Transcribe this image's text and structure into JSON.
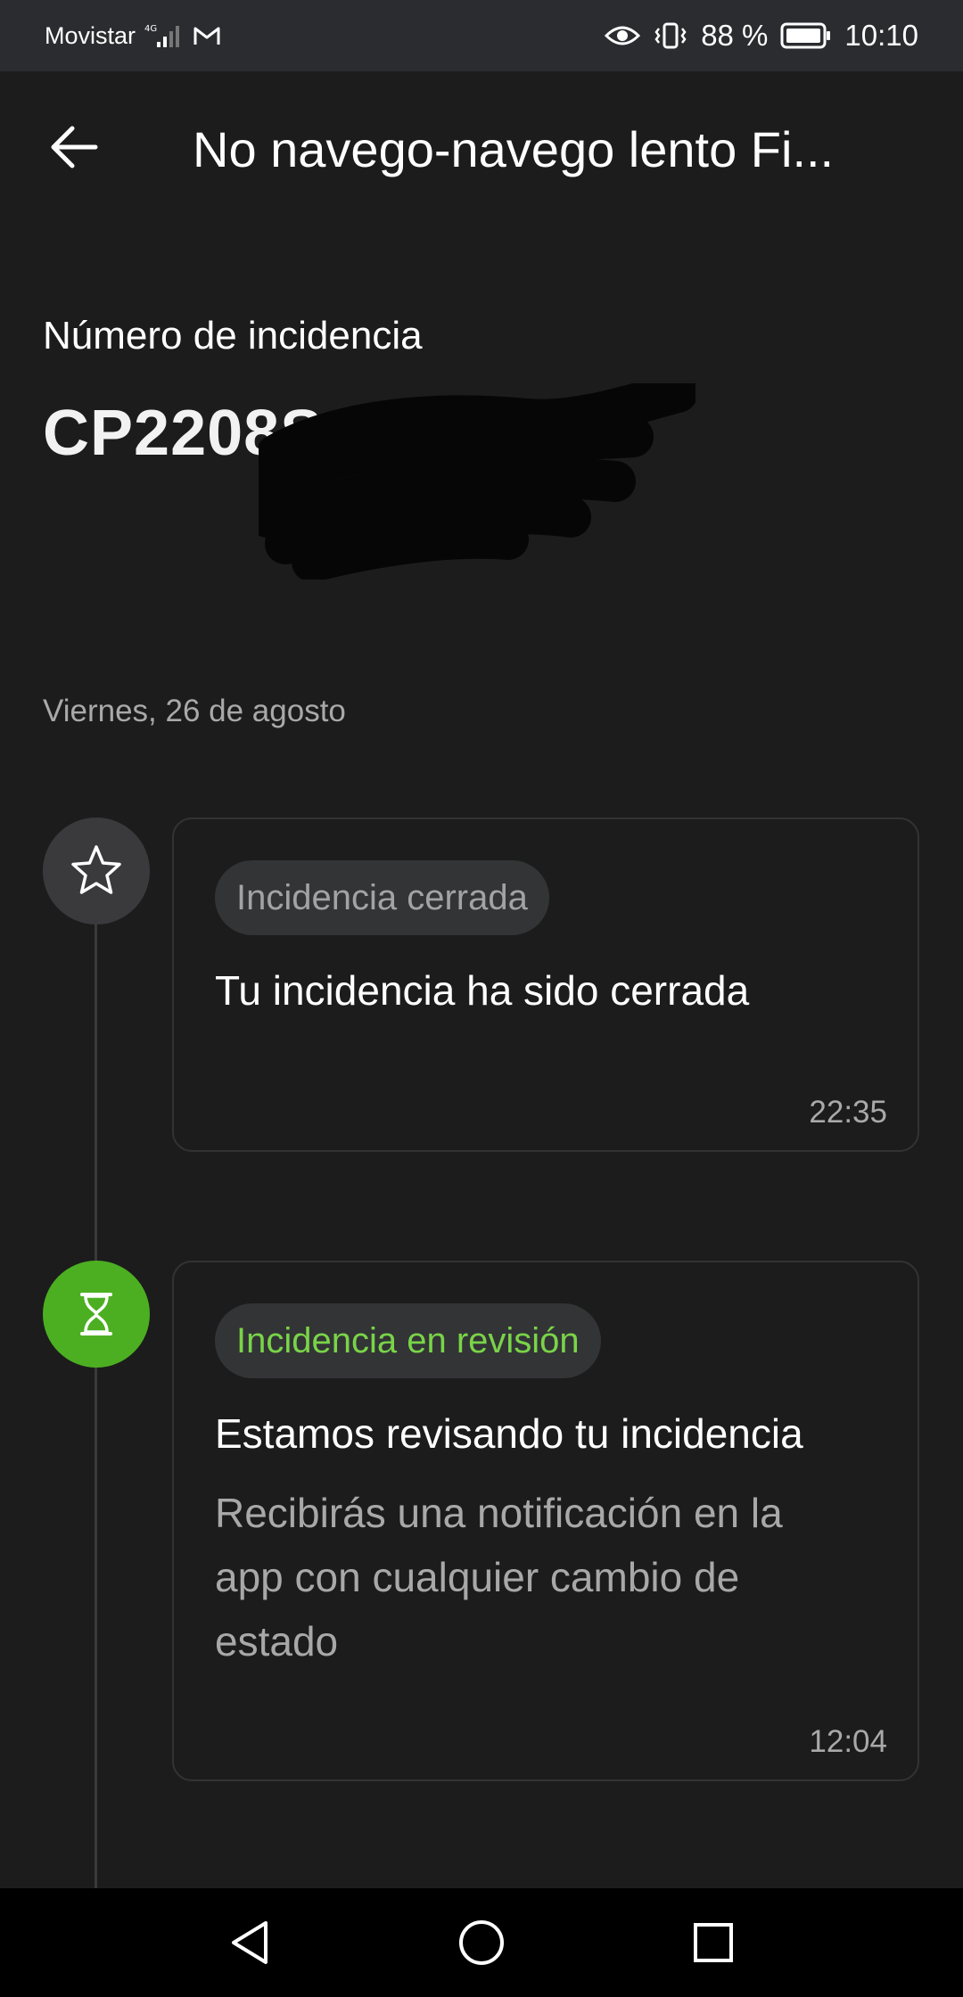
{
  "status_bar": {
    "carrier": "Movistar",
    "network": "4G",
    "battery": "88 %",
    "time": "10:10"
  },
  "header": {
    "title": "No navego-navego lento Fi..."
  },
  "incidence": {
    "label": "Número de incidencia",
    "number": "CP2208S"
  },
  "timeline": {
    "date": "Viernes, 26 de agosto",
    "events": [
      {
        "status": "Incidencia cerrada",
        "message": "Tu incidencia ha sido cerrada",
        "detail": "",
        "time": "22:35",
        "icon": "star-icon"
      },
      {
        "status": "Incidencia en revisión",
        "message": "Estamos revisando tu incidencia",
        "detail": "Recibirás una notificación en la app con cualquier cambio de estado",
        "time": "12:04",
        "icon": "hourglass-icon"
      }
    ]
  },
  "colors": {
    "background": "#1c1c1c",
    "accent_green": "#4caf22",
    "review_text": "#79d448"
  }
}
